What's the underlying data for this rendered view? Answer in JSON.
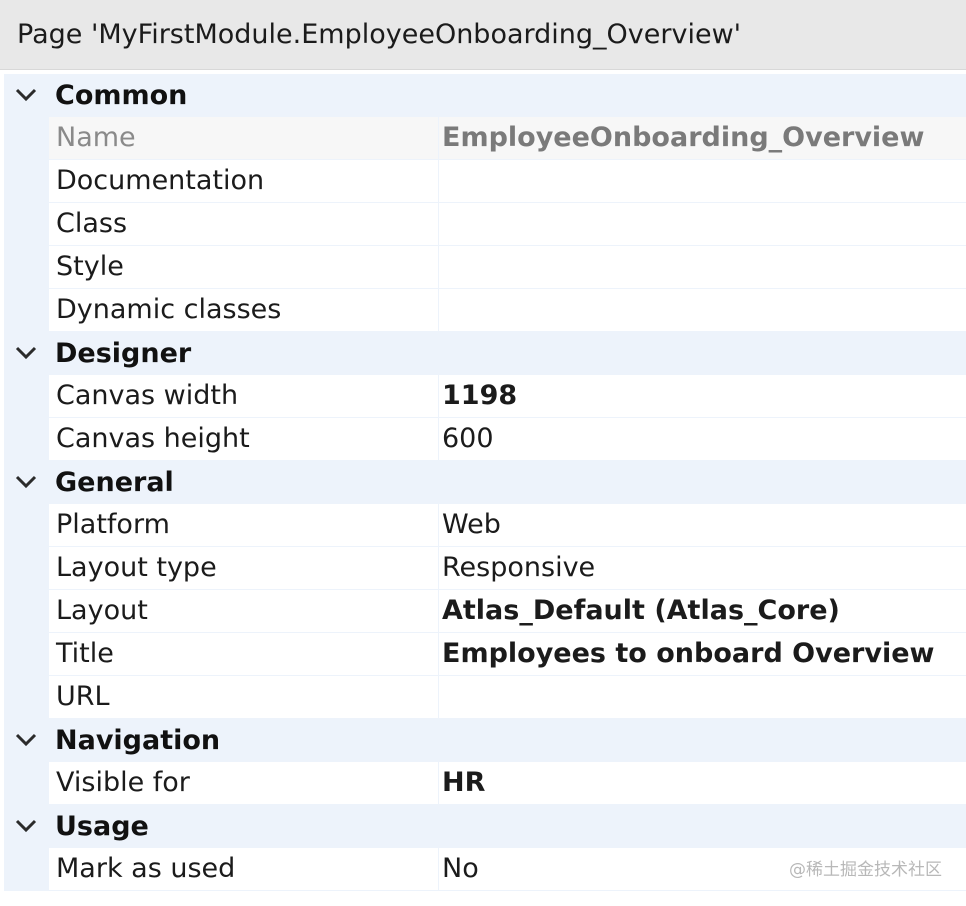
{
  "window": {
    "title": "Page 'MyFirstModule.EmployeeOnboarding_Overview'"
  },
  "categories": {
    "common": {
      "label": "Common",
      "rows": {
        "name": {
          "label": "Name",
          "value": "EmployeeOnboarding_Overview"
        },
        "documentation": {
          "label": "Documentation",
          "value": ""
        },
        "class": {
          "label": "Class",
          "value": ""
        },
        "style": {
          "label": "Style",
          "value": ""
        },
        "dynamic_classes": {
          "label": "Dynamic classes",
          "value": ""
        }
      }
    },
    "designer": {
      "label": "Designer",
      "rows": {
        "canvas_width": {
          "label": "Canvas width",
          "value": "1198"
        },
        "canvas_height": {
          "label": "Canvas height",
          "value": "600"
        }
      }
    },
    "general": {
      "label": "General",
      "rows": {
        "platform": {
          "label": "Platform",
          "value": "Web"
        },
        "layout_type": {
          "label": "Layout type",
          "value": "Responsive"
        },
        "layout": {
          "label": "Layout",
          "value": "Atlas_Default (Atlas_Core)"
        },
        "title": {
          "label": "Title",
          "value": "Employees to onboard Overview"
        },
        "url": {
          "label": "URL",
          "value": ""
        }
      }
    },
    "navigation": {
      "label": "Navigation",
      "rows": {
        "visible_for": {
          "label": "Visible for",
          "value": "HR"
        }
      }
    },
    "usage": {
      "label": "Usage",
      "rows": {
        "mark_as_used": {
          "label": "Mark as used",
          "value": "No"
        }
      }
    }
  },
  "icons": {
    "expand": "chevron-down-icon"
  },
  "colors": {
    "category_background": "#edf3fb",
    "title_bar": "#e8e8e8",
    "readonly_text": "#8a8a8a"
  },
  "watermark": "@稀土掘金技术社区"
}
